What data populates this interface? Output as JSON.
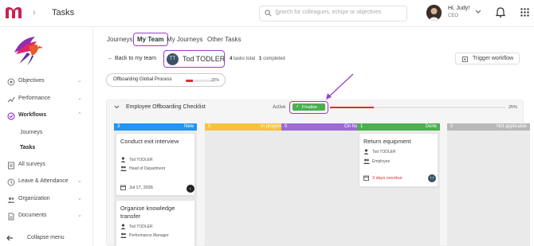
{
  "header": {
    "breadcrumb_title": "Tasks",
    "search_placeholder": "Search for colleagues, echipe or objectives",
    "greeting": "Hi, Judy!",
    "role": "CEO"
  },
  "sidebar": {
    "items": [
      {
        "label": "Objectives",
        "icon": "target-icon"
      },
      {
        "label": "Performance",
        "icon": "trend-icon"
      },
      {
        "label": "Workflows",
        "icon": "check-circle-icon"
      },
      {
        "label": "All surveys",
        "icon": "survey-icon"
      },
      {
        "label": "Leave & Attendance",
        "icon": "clock-icon"
      },
      {
        "label": "Organization",
        "icon": "people-icon"
      },
      {
        "label": "Documents",
        "icon": "document-icon"
      }
    ],
    "sub_items": [
      "Journeys",
      "Tasks"
    ],
    "collapse_label": "Collapse menu"
  },
  "tabs": [
    "Journeys",
    "My Team",
    "My Journeys",
    "Other Tasks"
  ],
  "back_label": "Back to my team",
  "member": {
    "initials": "TT",
    "name": "Tod TODLER"
  },
  "counts": {
    "total_num": "4",
    "total_label": "tasks total",
    "completed_num": "1",
    "completed_label": "completed"
  },
  "trigger_label": "Trigger workflow",
  "process": {
    "label": "Offboarding Global Process",
    "percent_text": "25%",
    "progress": 0.25
  },
  "checklist": {
    "title": "Employee Offboarding Checklist",
    "status": "Active",
    "finalise_label": "Finalise",
    "percent_text": "25%",
    "progress": 0.25
  },
  "columns": [
    {
      "count": "3",
      "label": "New",
      "color": "#2196f3"
    },
    {
      "count": "0",
      "label": "In progress",
      "color": "#f5c242"
    },
    {
      "count": "0",
      "label": "On hold",
      "color": "#9c6bd6"
    },
    {
      "count": "1",
      "label": "Done",
      "color": "#4caf50"
    },
    {
      "count": "0",
      "label": "Not applicable",
      "color": "#b8b8b8"
    }
  ],
  "cards": {
    "c1": {
      "title": "Conduct exit interview",
      "assignee": "Tod TODLER",
      "group": "Head of Department",
      "date": "Jul 17, 2026",
      "avatar": "L"
    },
    "c2": {
      "title": "Organise knowledge transfer",
      "assignee": "Tod TODLER",
      "group": "Performance Manager"
    },
    "c3": {
      "title": "Return equipment",
      "assignee": "Tod TODLER",
      "group": "Employee",
      "date": "3 days overdue",
      "avatar": "TT"
    }
  },
  "colors": {
    "accent": "#9b3fc6",
    "danger": "#d83030",
    "success": "#4caf50"
  }
}
